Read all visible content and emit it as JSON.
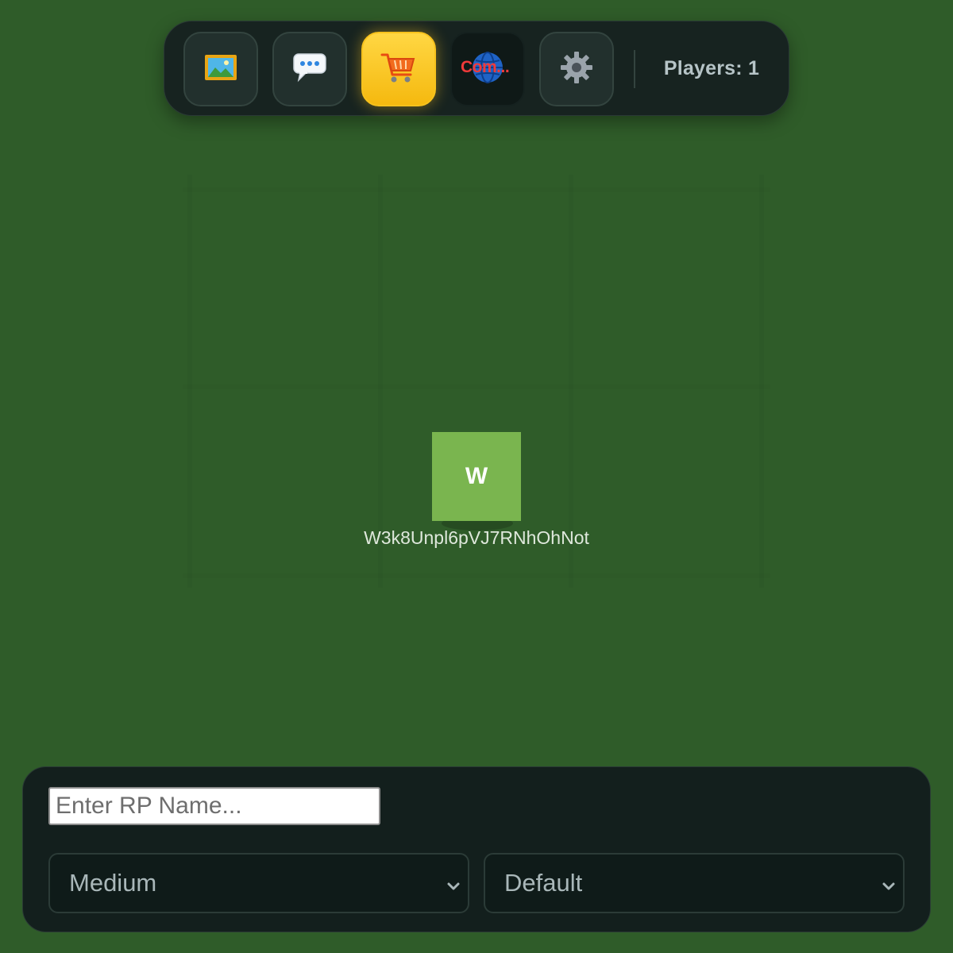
{
  "toolbar": {
    "buttons": [
      {
        "id": "gallery",
        "icon": "framed-picture-icon",
        "active": false
      },
      {
        "id": "chat",
        "icon": "speech-bubble-icon",
        "active": false
      },
      {
        "id": "shop",
        "icon": "shopping-cart-icon",
        "active": true
      },
      {
        "id": "community",
        "icon": "globe-icon",
        "label": "Com...",
        "active": false
      },
      {
        "id": "settings",
        "icon": "gear-icon",
        "active": false
      }
    ],
    "players_label": "Players: 1"
  },
  "player": {
    "initial": "W",
    "name": "W3k8Unpl6pVJ7RNhOhNot",
    "color": "#7ab54f"
  },
  "panel": {
    "rp_name_placeholder": "Enter RP Name...",
    "size_select": {
      "selected": "Medium"
    },
    "style_select": {
      "selected": "Default"
    }
  },
  "colors": {
    "background": "#2f5c29",
    "toolbar": "#172320",
    "active_button": "#ffd743",
    "panel": "#131f1d"
  }
}
